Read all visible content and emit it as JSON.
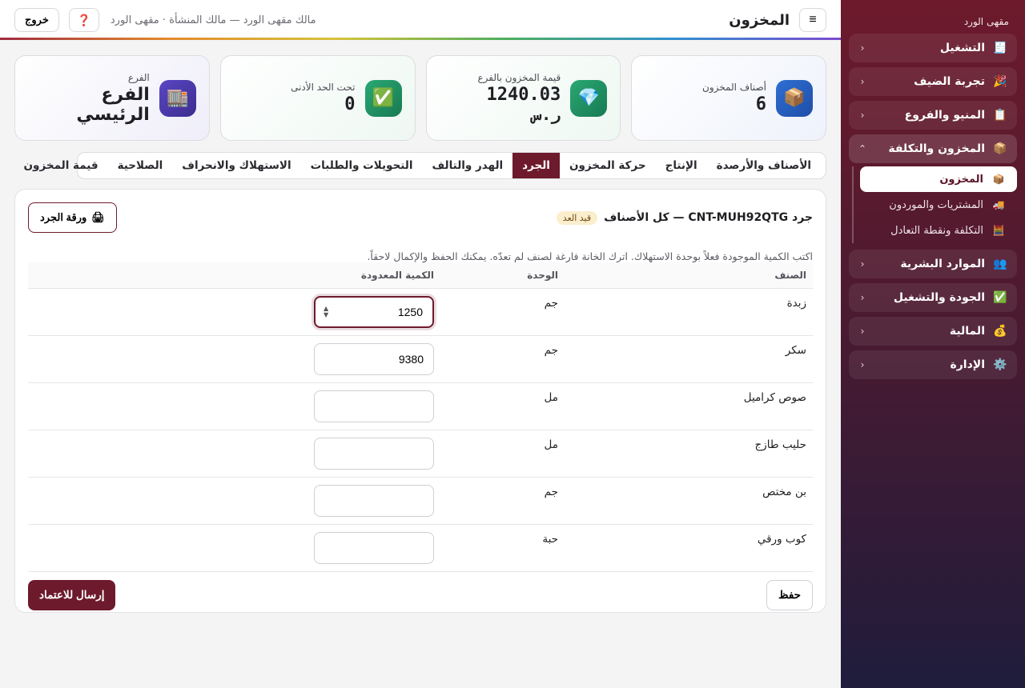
{
  "sidebar": {
    "brand": "مقهى الورد",
    "items": [
      {
        "label": "التشغيل",
        "icon": "🧾"
      },
      {
        "label": "تجربة الضيف",
        "icon": "🎉"
      },
      {
        "label": "المنيو والفروع",
        "icon": "📋"
      },
      {
        "label": "المخزون والتكلفة",
        "icon": "📦"
      },
      {
        "label": "الموارد البشرية",
        "icon": "👥"
      },
      {
        "label": "الجودة والتشغيل",
        "icon": "✅"
      },
      {
        "label": "المالية",
        "icon": "💰"
      },
      {
        "label": "الإدارة",
        "icon": "⚙️"
      }
    ],
    "chev_collapsed": "‹",
    "chev_open": "⌃",
    "sub_items": [
      {
        "label": "المخزون",
        "icon": "📦"
      },
      {
        "label": "المشتريات والموردون",
        "icon": "🚚"
      },
      {
        "label": "التكلفة ونقطة التعادل",
        "icon": "🧮"
      }
    ]
  },
  "topbar": {
    "menu_icon": "≡",
    "title": "المخزون",
    "owner": "مالك مقهى الورد — مالك المنشأة · مقهى الورد",
    "help_icon": "❓",
    "logout": "خروج"
  },
  "stats": [
    {
      "label": "أصناف المخزون",
      "value": "6",
      "icon": "📦"
    },
    {
      "label": "قيمة المخزون بالفرع",
      "value": "1240.03",
      "sub": "ر.س",
      "icon": "💎"
    },
    {
      "label": "تحت الحد الأدنى",
      "value": "0",
      "icon": "✅"
    },
    {
      "label": "الفرع",
      "value": "الفرع الرئيسي",
      "icon": "🏬"
    }
  ],
  "tabs": [
    "الأصناف والأرصدة",
    "الإنتاج",
    "حركة المخزون",
    "الجرد",
    "الهدر والتالف",
    "التحويلات والطلبات",
    "الاستهلاك والانحراف",
    "الصلاحية",
    "قيمة المخزون"
  ],
  "active_tab": "الجرد",
  "count": {
    "title": "جرد CNT-MUH92QTG — كل الأصناف",
    "badge": "قيد العد",
    "print_label": "ورقة الجرد",
    "print_icon": "🖨",
    "hint": "اكتب الكمية الموجودة فعلاً بوحدة الاستهلاك. اترك الخانة فارغة لصنف لم تعدّه. يمكنك الحفظ والإكمال لاحقاً.",
    "columns": {
      "name": "الصنف",
      "unit": "الوحدة",
      "qty": "الكمية المعدودة"
    },
    "rows": [
      {
        "name": "زبدة",
        "unit": "جم",
        "qty": "1250"
      },
      {
        "name": "سكر",
        "unit": "جم",
        "qty": "9380"
      },
      {
        "name": "صوص كراميل",
        "unit": "مل",
        "qty": ""
      },
      {
        "name": "حليب طازج",
        "unit": "مل",
        "qty": ""
      },
      {
        "name": "بن مختص",
        "unit": "جم",
        "qty": ""
      },
      {
        "name": "كوب ورقي",
        "unit": "حبة",
        "qty": ""
      }
    ],
    "save_label": "حفظ",
    "submit_label": "إرسال للاعتماد"
  },
  "colors": {
    "accent": "#6d1a2c",
    "badge_bg": "#fbeecd"
  }
}
